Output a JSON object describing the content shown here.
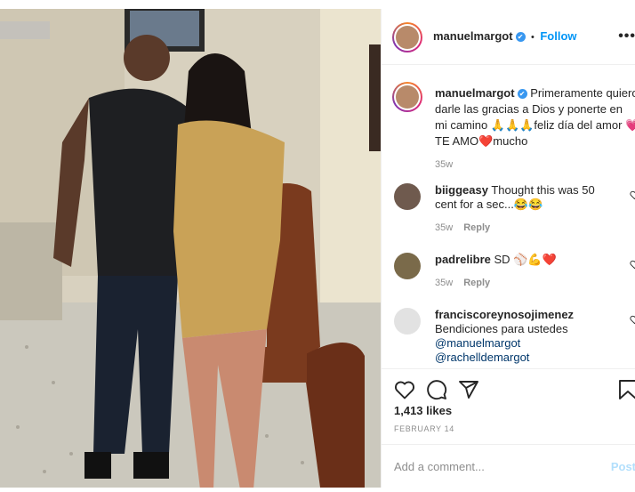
{
  "post": {
    "username": "manuelmargot",
    "verified_mark": "✔",
    "follow_label": "Follow",
    "separator": "•",
    "more_label": "•••"
  },
  "caption": {
    "username": "manuelmargot",
    "line1": "Primeramente quiero",
    "line2": "darle las gracias a Dios y ponerte en",
    "line3": "mi camino 🙏🙏🙏feliz día del amor 💗",
    "line4": "TE AMO❤️mucho",
    "time": "35w"
  },
  "comments": [
    {
      "username": "biiggeasy",
      "line1": "Thought this was 50",
      "line2": "cent for a sec...😂😂",
      "time": "35w",
      "reply": "Reply"
    },
    {
      "username": "padrelibre",
      "line1": "SD ⚾💪❤️",
      "time": "35w",
      "reply": "Reply"
    },
    {
      "username": "franciscoreynosojimenez",
      "line1": "Bendiciones para ustedes",
      "mention1": "@manuelmargot",
      "mention2": "@rachelldemargot"
    }
  ],
  "likes": "1,413 likes",
  "date": "FEBRUARY 14",
  "add_comment": {
    "placeholder": "Add a comment...",
    "post_label": "Post"
  },
  "icons": [
    "heart-icon",
    "comment-icon",
    "share-icon",
    "bookmark-icon",
    "more-icon",
    "verified-icon"
  ],
  "colors": {
    "follow": "#0095f6",
    "muted": "#8e8e8e",
    "mention": "#00376b",
    "post_disabled": "#b2dffc"
  }
}
